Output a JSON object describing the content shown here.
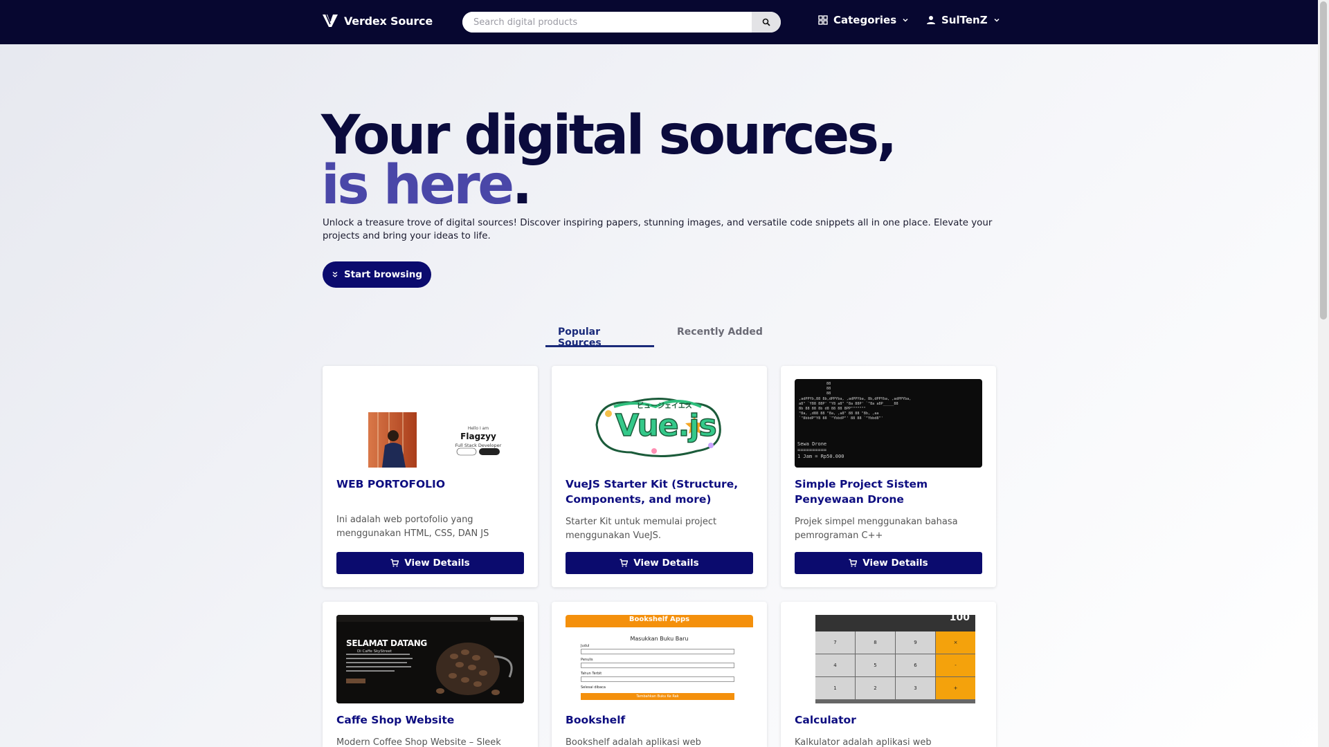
{
  "navbar": {
    "brand": "Verdex Source",
    "search_placeholder": "Search digital products",
    "categories_label": "Categories",
    "user_label": "SulTenZ"
  },
  "hero": {
    "title_line1": "Your digital sources,",
    "title_line2": "is here",
    "title_dot": ".",
    "description": "Unlock a treasure trove of digital sources! Discover inspiring papers, stunning images, and versatile code snippets all in one place. Elevate your projects and bring your ideas to life.",
    "cta_label": "Start browsing"
  },
  "tabs": [
    {
      "label": "Popular Sources",
      "active": true
    },
    {
      "label": "Recently Added",
      "active": false
    }
  ],
  "cards": [
    {
      "title": "WEB PORTOFOLIO",
      "description": "Ini adalah web portofolio yang menggunakan HTML, CSS, DAN JS",
      "button": "View Details",
      "thumb": {
        "name": "Flagzyy",
        "role": "Full Stack Developer",
        "hello": "Hello I am"
      }
    },
    {
      "title": "VueJS Starter Kit (Structure, Components, and more)",
      "description": "Starter Kit untuk memulai project menggunakan VueJS.",
      "button": "View Details",
      "thumb": {
        "logo_text": "Vue.js",
        "kana": "ビュージェイエス"
      }
    },
    {
      "title": "Simple Project Sistem Penyewaan Drone",
      "description": "Projek simpel menggunakan bahasa pemrograman C++",
      "button": "View Details",
      "thumb": {
        "line1": "Sewa Drone",
        "line2": "==========",
        "line3": "1 Jam = Rp50.000"
      }
    },
    {
      "title": "Caffe Shop Website",
      "description": "Modern Coffee Shop Website – Sleek",
      "thumb": {
        "headline": "SELAMAT DATANG",
        "sub": "Di Caffe SkyStreet"
      }
    },
    {
      "title": "Bookshelf",
      "description": "Bookshelf adalah aplikasi web sederhana",
      "thumb": {
        "header": "Bookshelf Apps",
        "form_title": "Masukkan Buku Baru",
        "f1": "Judul",
        "f2": "Penulis",
        "f3": "Tahun Terbit",
        "check": "Selesai dibaca",
        "submit": "Tambahkan Buku Ke Rak"
      }
    },
    {
      "title": "Calculator",
      "description": "Kalkulator adalah aplikasi web sederhana",
      "thumb": {
        "display": "100",
        "keys": [
          "7",
          "8",
          "9",
          "×",
          "4",
          "5",
          "6",
          "-",
          "1",
          "2",
          "3",
          "+"
        ]
      }
    }
  ],
  "colors": {
    "navbar_bg": "#070730",
    "primary_button": "#0b0b6e",
    "title_dark": "#0b0b3d",
    "title_accent": "#4a47a8",
    "card_title": "#0d0d80"
  }
}
